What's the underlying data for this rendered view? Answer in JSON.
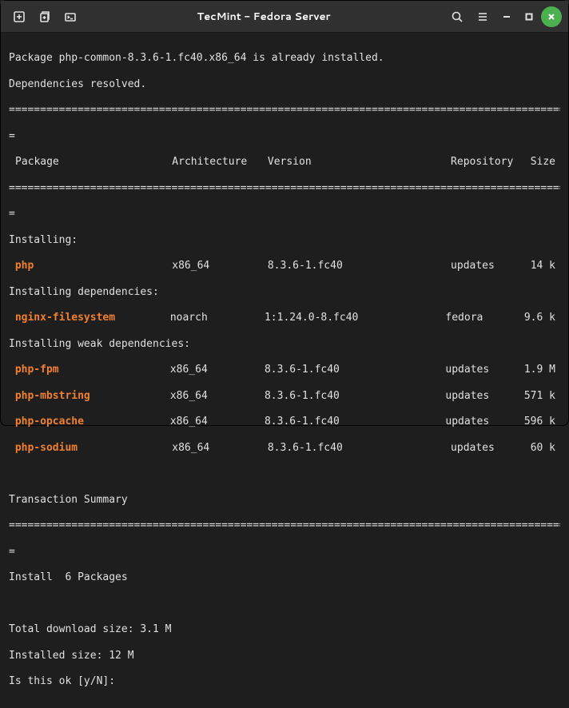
{
  "titlebar": {
    "title": "TecMint - Fedora Server"
  },
  "output": {
    "line_installed": "Package php-common-8.3.6-1.fc40.x86_64 is already installed.",
    "line_resolved": "Dependencies resolved.",
    "sep_long": "================================================================================================",
    "sep_short": "=",
    "headers": {
      "pkg": "Package",
      "arch": "Architecture",
      "ver": "Version",
      "repo": "Repository",
      "size": "Size"
    },
    "section_installing": "Installing:",
    "section_deps": "Installing dependencies:",
    "section_weak": "Installing weak dependencies:",
    "rows": {
      "php": {
        "name": "php",
        "arch": "x86_64",
        "ver": "8.3.6-1.fc40",
        "repo": "updates",
        "size": "14 k"
      },
      "nginx": {
        "name": "nginx-filesystem",
        "arch": "noarch",
        "ver": "1:1.24.0-8.fc40",
        "repo": "fedora",
        "size": "9.6 k"
      },
      "fpm": {
        "name": "php-fpm",
        "arch": "x86_64",
        "ver": "8.3.6-1.fc40",
        "repo": "updates",
        "size": "1.9 M"
      },
      "mbstring": {
        "name": "php-mbstring",
        "arch": "x86_64",
        "ver": "8.3.6-1.fc40",
        "repo": "updates",
        "size": "571 k"
      },
      "opcache": {
        "name": "php-opcache",
        "arch": "x86_64",
        "ver": "8.3.6-1.fc40",
        "repo": "updates",
        "size": "596 k"
      },
      "sodium": {
        "name": "php-sodium",
        "arch": "x86_64",
        "ver": "8.3.6-1.fc40",
        "repo": "updates",
        "size": "60 k"
      }
    },
    "txn_summary": "Transaction Summary",
    "install_count": "Install  6 Packages",
    "total_download": "Total download size: 3.1 M",
    "installed_size": "Installed size: 12 M",
    "prompt": "Is this ok [y/N]: "
  }
}
